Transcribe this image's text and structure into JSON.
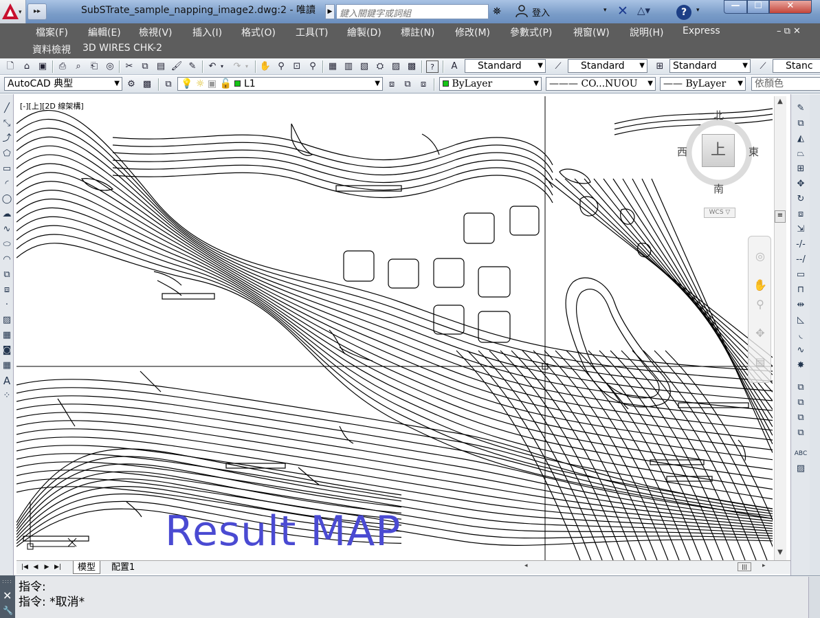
{
  "window": {
    "title": "SubSTrate_sample_napping_image2.dwg:2 - 唯讀",
    "search_placeholder": "鍵入關鍵字或詞組",
    "login_label": "登入",
    "min_label": "—",
    "max_label": "☐",
    "close_label": "✕"
  },
  "menu": {
    "items": [
      "檔案(F)",
      "編輯(E)",
      "檢視(V)",
      "插入(I)",
      "格式(O)",
      "工具(T)",
      "繪製(D)",
      "標註(N)",
      "修改(M)",
      "參數式(P)",
      "視窗(W)",
      "說明(H)",
      "Express"
    ],
    "items_row2": [
      "資料檢視",
      "3D WIRES CHK-2"
    ],
    "mdi_controls": "– ⧉ ✕"
  },
  "toolbar1": {
    "text_style": "Standard",
    "dim_style": "Standard",
    "table_style": "Standard",
    "mleader_style": "Stanc"
  },
  "toolbar2": {
    "workspace": "AutoCAD 典型",
    "layer": "L1",
    "color": "ByLayer",
    "linetype": "CO...NUOU",
    "lineweight": "ByLayer",
    "plot_style": "依顏色"
  },
  "viewport": {
    "label": "[-][上][2D 線架構]",
    "overlay_text": "Result MAP"
  },
  "viewcube": {
    "north": "北",
    "south": "南",
    "east": "東",
    "west": "西",
    "face": "上",
    "wcs": "WCS ▽"
  },
  "layout_tabs": {
    "model": "模型",
    "layout1": "配置1"
  },
  "command_line": {
    "line1": "指令:",
    "line2": "指令: *取消*"
  },
  "colors": {
    "menubar_bg": "#5d5d5d",
    "overlay_text": "#4a4ad2",
    "drawing_bg": "#ffffff"
  }
}
